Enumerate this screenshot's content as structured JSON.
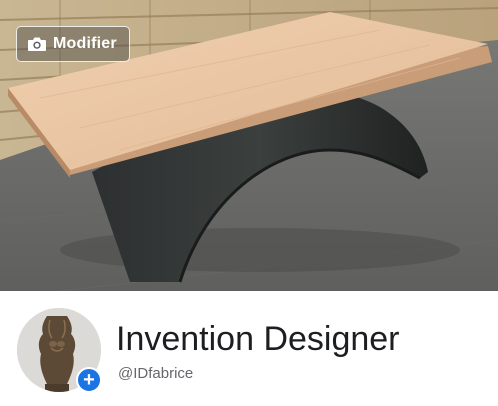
{
  "cover": {
    "photo_name": "wooden-bench-cover-photo",
    "modify_button": {
      "label": "Modifier",
      "icon": "camera-icon"
    }
  },
  "profile": {
    "name": "Invention Designer",
    "handle": "@IDfabrice",
    "add_badge_icon": "plus-icon"
  },
  "colors": {
    "accent": "#1b74e4",
    "name_text": "#1c1e21",
    "handle_text": "#65676b"
  }
}
